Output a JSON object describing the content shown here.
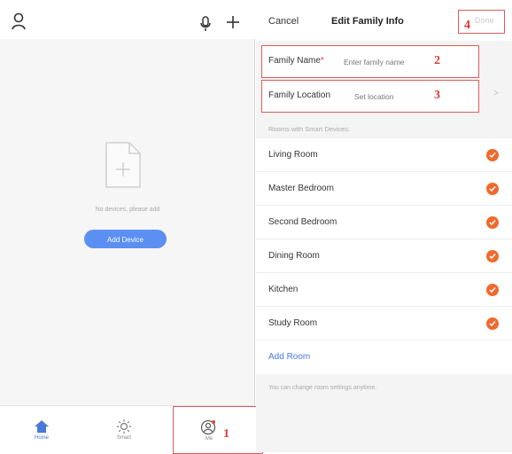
{
  "left": {
    "empty_text": "No devices, please add",
    "add_device_label": "Add Device",
    "tabs": [
      {
        "label": "Home",
        "icon": "home-icon"
      },
      {
        "label": "Smart",
        "icon": "sun-icon"
      },
      {
        "label": "Me",
        "icon": "user-circle-icon"
      }
    ],
    "annotation_1": "1"
  },
  "right": {
    "cancel": "Cancel",
    "title": "Edit Family Info",
    "done": "Done",
    "annotation_4": "4",
    "family_name": {
      "label": "Family Name",
      "required_mark": "*",
      "placeholder": "Enter family name",
      "annotation": "2"
    },
    "family_location": {
      "label": "Family Location",
      "placeholder": "Set location",
      "annotation": "3"
    },
    "rooms_header": "Rooms with Smart Devices:",
    "rooms": [
      "Living Room",
      "Master Bedroom",
      "Second Bedroom",
      "Dining Room",
      "Kitchen",
      "Study Room"
    ],
    "add_room": "Add Room",
    "footer_note": "You can change room settings anytime."
  },
  "colors": {
    "accent_blue": "#5b8ff2",
    "check_orange": "#ef6a2d",
    "annotation_red": "#d83a3a"
  }
}
